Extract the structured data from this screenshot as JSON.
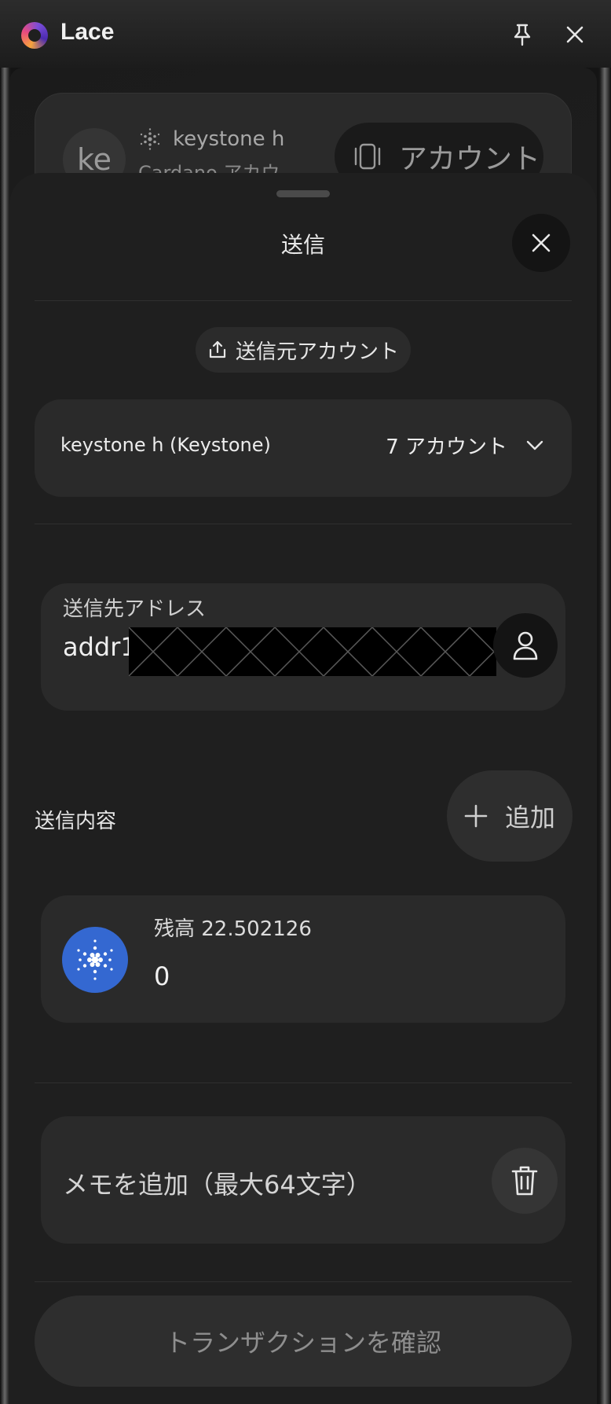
{
  "app": {
    "title": "Lace",
    "icons": {
      "logo": "lace-logo-icon",
      "pin": "pin-icon",
      "close": "close-icon"
    }
  },
  "background_wallet": {
    "avatar_initials": "ke",
    "wallet_name": "keystone h",
    "wallet_sub": "Cardano アカウ",
    "accounts_button_label": "アカウント"
  },
  "sheet": {
    "title": "送信",
    "from_account_label": "送信元アカウント",
    "account_select": {
      "name": "keystone h (Keystone)",
      "count_label": "7 アカウント"
    },
    "recipient": {
      "label": "送信先アドレス",
      "value_prefix": "addr1"
    },
    "contents": {
      "label": "送信内容",
      "add_label": "追加"
    },
    "asset": {
      "balance_label": "残高 22.502126",
      "amount": "0"
    },
    "memo": {
      "placeholder": "メモを追加（最大64文字）"
    },
    "confirm_label": "トランザクションを確認"
  }
}
